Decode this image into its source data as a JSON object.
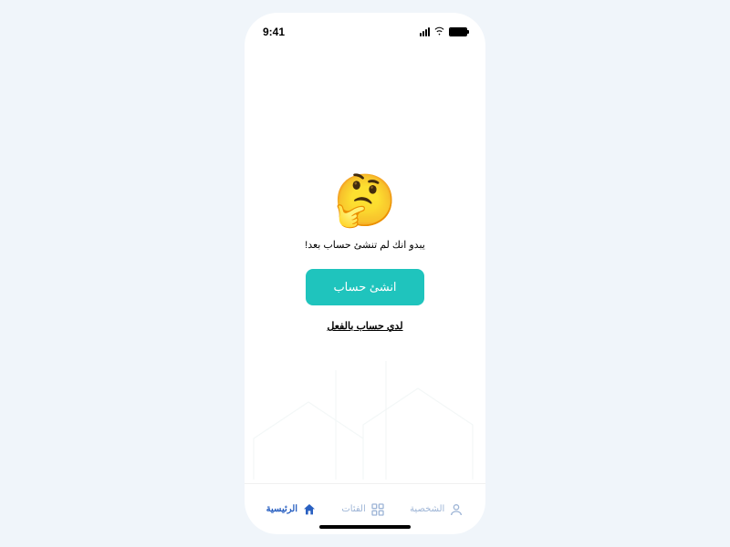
{
  "statusBar": {
    "time": "9:41"
  },
  "emptyState": {
    "emoji": "🤔",
    "message": "يبدو انك لم تنشئ حساب بعد!",
    "primaryButton": "انشئ حساب",
    "secondaryLink": "لدي حساب بالفعل"
  },
  "tabbar": {
    "items": [
      {
        "label": "الرئيسية",
        "icon": "home",
        "active": true
      },
      {
        "label": "الفئات",
        "icon": "grid",
        "active": false
      },
      {
        "label": "الشخصية",
        "icon": "user",
        "active": false
      }
    ]
  }
}
